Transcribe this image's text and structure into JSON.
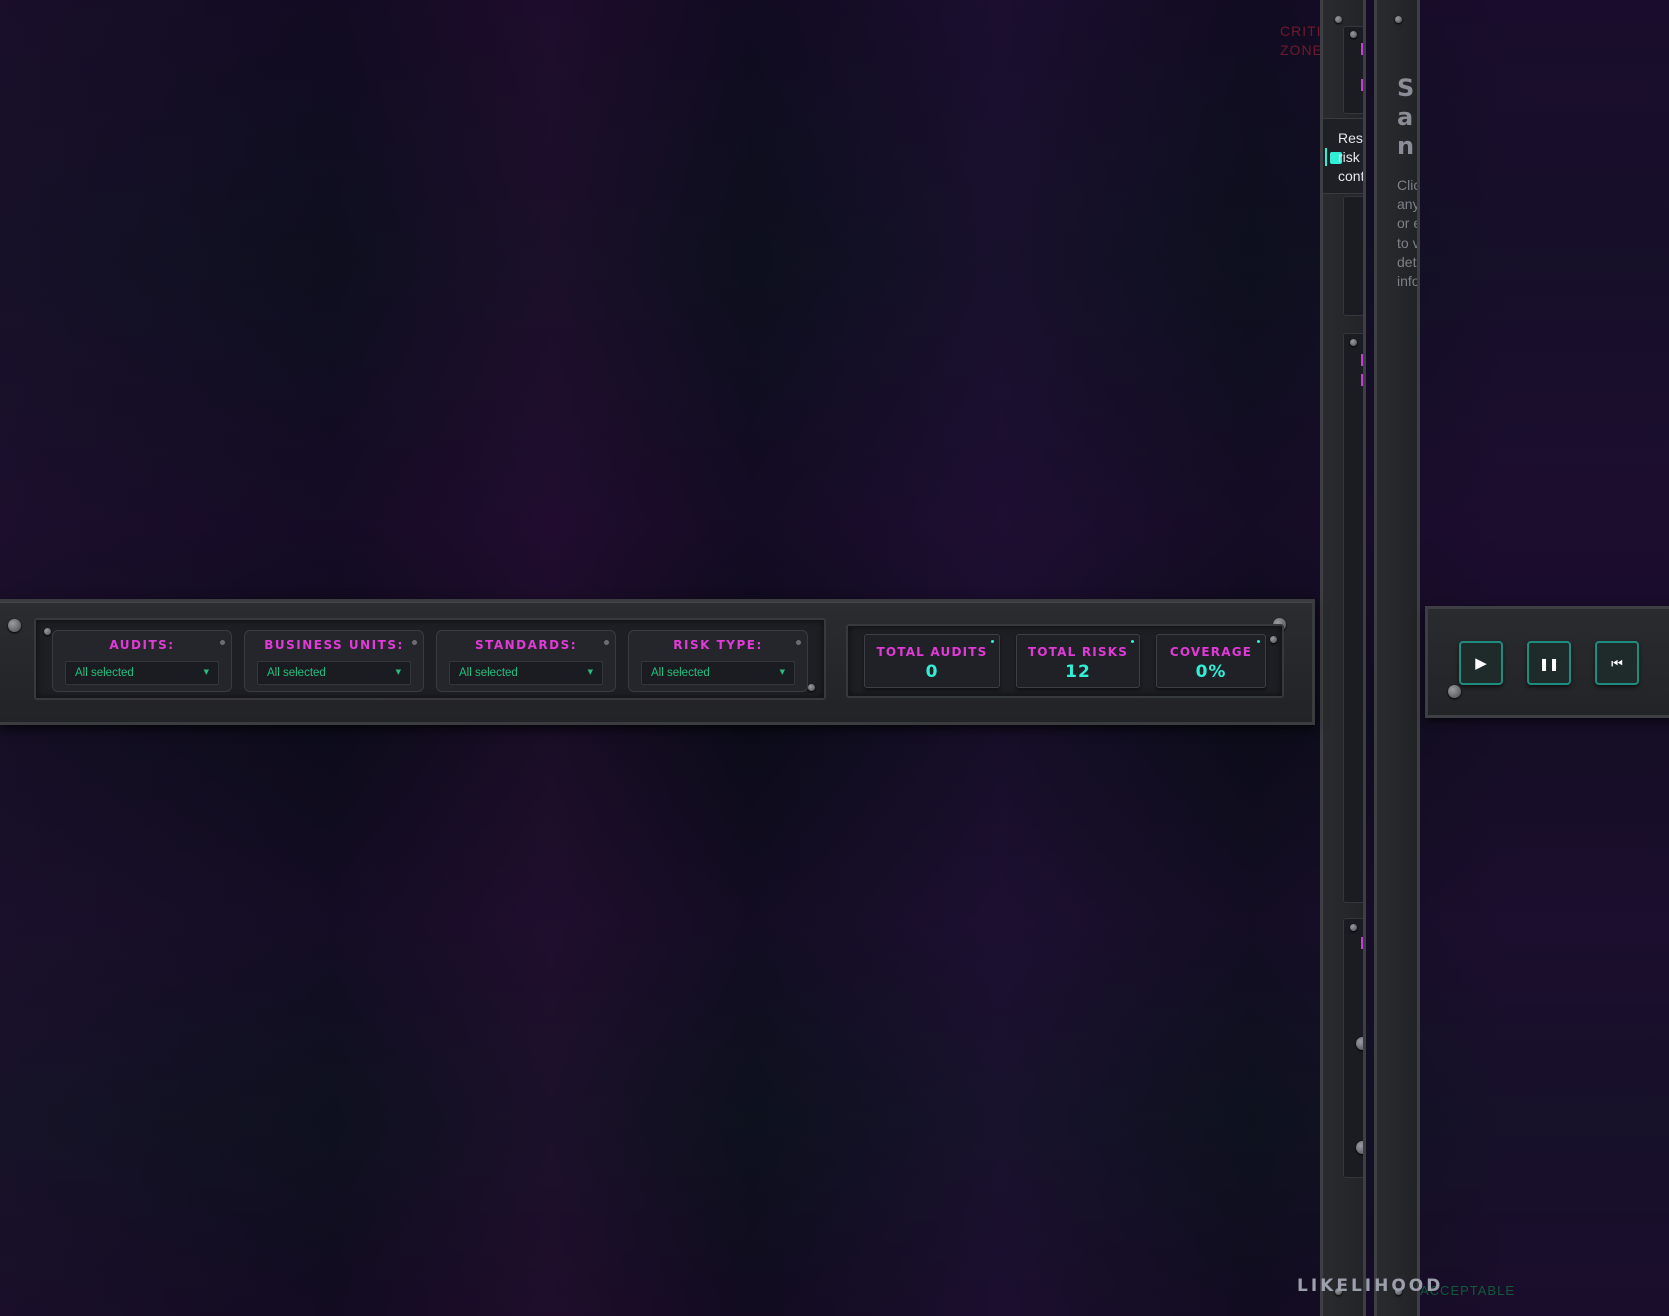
{
  "background": {
    "zone_critical": "CRITICAL ZONE",
    "zone_acceptable": "ACCEPTABLE",
    "axis_likelihood": "LIKELIHOOD"
  },
  "filters": [
    {
      "label": "AUDITS:",
      "value": "All selected"
    },
    {
      "label": "BUSINESS UNITS:",
      "value": "All selected"
    },
    {
      "label": "STANDARDS:",
      "value": "All selected"
    },
    {
      "label": "RISK TYPE:",
      "value": "All selected"
    }
  ],
  "stats": [
    {
      "label": "TOTAL AUDITS",
      "value": "0"
    },
    {
      "label": "TOTAL RISKS",
      "value": "12"
    },
    {
      "label": "COVERAGE",
      "value": "0%"
    }
  ],
  "legend": {
    "residual_label": "Residual risk control"
  },
  "details": {
    "title": "Select a node",
    "body": "Click on any risk or entity to view details information"
  },
  "playback": {
    "play_icon": "play-icon",
    "pause_icon": "pause-icon",
    "rewind_icon": "rewind-icon"
  },
  "colors": {
    "accent_magenta": "#e13ad8",
    "accent_cyan": "#2ff0d4",
    "accent_green": "#22c07f",
    "panel": "#2a2b2f"
  }
}
